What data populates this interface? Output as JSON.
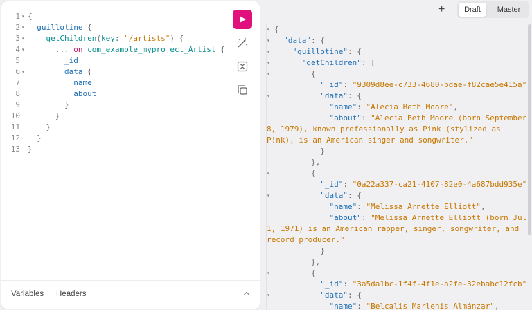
{
  "toolbar": {
    "add_tab": "+",
    "env_draft": "Draft",
    "env_master": "Master"
  },
  "editor": {
    "lines": [
      {
        "n": "1",
        "fold": true
      },
      {
        "n": "2",
        "fold": true
      },
      {
        "n": "3",
        "fold": true
      },
      {
        "n": "4",
        "fold": true
      },
      {
        "n": "5",
        "fold": false
      },
      {
        "n": "6",
        "fold": true
      },
      {
        "n": "7",
        "fold": false
      },
      {
        "n": "8",
        "fold": false
      },
      {
        "n": "9",
        "fold": false
      },
      {
        "n": "10",
        "fold": false
      },
      {
        "n": "11",
        "fold": false
      },
      {
        "n": "12",
        "fold": false
      },
      {
        "n": "13",
        "fold": false
      }
    ],
    "query_root": "guillotine",
    "query_fn": "getChildren",
    "arg_key": "key",
    "arg_value": "\"/artists\"",
    "spread": "...",
    "on_kw": "on",
    "type_name": "com_example_myproject_Artist",
    "f_id": "_id",
    "f_data": "data",
    "f_name": "name",
    "f_about": "about"
  },
  "bottom": {
    "variables_tab": "Variables",
    "headers_tab": "Headers"
  },
  "result": {
    "k_data": "\"data\"",
    "k_guillotine": "\"guillotine\"",
    "k_getChildren": "\"getChildren\"",
    "k_id": "\"_id\"",
    "k_name": "\"name\"",
    "k_about": "\"about\"",
    "items": [
      {
        "id": "\"9309d8ee-c733-4680-bdae-f82cae5e415a\"",
        "name": "\"Alecia Beth Moore\"",
        "about_1": "\"Alecia Beth Moore (born September",
        "about_2": "8, 1979), known professionally as Pink (stylized as",
        "about_3": "P!nk), is an American singer and songwriter.\""
      },
      {
        "id": "\"0a22a337-ca21-4107-82e0-4a687bdd935e\"",
        "name": "\"Melissa Arnette Elliott\"",
        "about_1": "\"Melissa Arnette Elliott (born July",
        "about_2": "1, 1971) is an American rapper, singer, songwriter, and",
        "about_3": "record producer.\""
      },
      {
        "id": "\"3a5da1bc-1f4f-4f1e-a2fe-32ebabc12fcb\"",
        "name": "\"Belcalis Marlenis Almánzar\""
      }
    ]
  }
}
